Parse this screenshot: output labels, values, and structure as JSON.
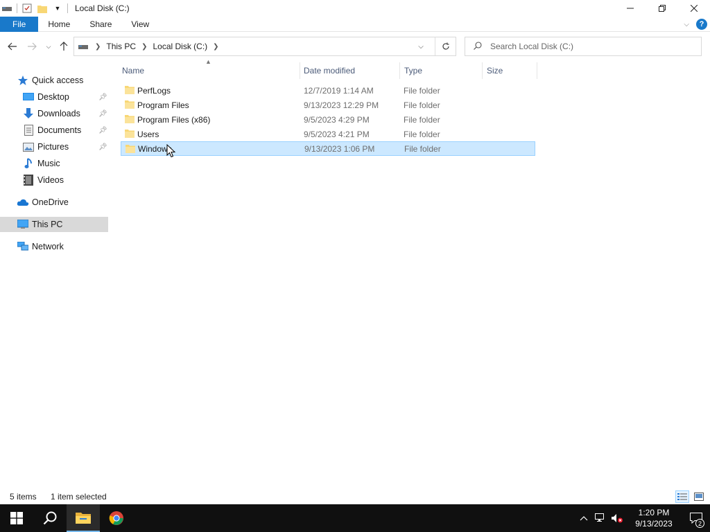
{
  "window": {
    "title": "Local Disk (C:)"
  },
  "ribbon": {
    "tabs": [
      "File",
      "Home",
      "Share",
      "View"
    ]
  },
  "address": {
    "segments": [
      "This PC",
      "Local Disk (C:)"
    ]
  },
  "search": {
    "placeholder": "Search Local Disk (C:)"
  },
  "sidebar": {
    "quick_access": "Quick access",
    "desktop": "Desktop",
    "downloads": "Downloads",
    "documents": "Documents",
    "pictures": "Pictures",
    "music": "Music",
    "videos": "Videos",
    "onedrive": "OneDrive",
    "this_pc": "This PC",
    "network": "Network"
  },
  "columns": {
    "name": "Name",
    "date": "Date modified",
    "type": "Type",
    "size": "Size"
  },
  "files": [
    {
      "name": "PerfLogs",
      "date": "12/7/2019 1:14 AM",
      "type": "File folder"
    },
    {
      "name": "Program Files",
      "date": "9/13/2023 12:29 PM",
      "type": "File folder"
    },
    {
      "name": "Program Files (x86)",
      "date": "9/5/2023 4:29 PM",
      "type": "File folder"
    },
    {
      "name": "Users",
      "date": "9/5/2023 4:21 PM",
      "type": "File folder"
    },
    {
      "name": "Windows",
      "date": "9/13/2023 1:06 PM",
      "type": "File folder"
    }
  ],
  "status": {
    "count": "5 items",
    "selection": "1 item selected"
  },
  "taskbar": {
    "time": "1:20 PM",
    "date": "9/13/2023",
    "notifications": "2"
  },
  "colors": {
    "accent": "#1979ca",
    "selection_bg": "#cce8ff",
    "selection_border": "#99d1ff",
    "folder": "#f8d775",
    "taskbar": "#101010"
  }
}
